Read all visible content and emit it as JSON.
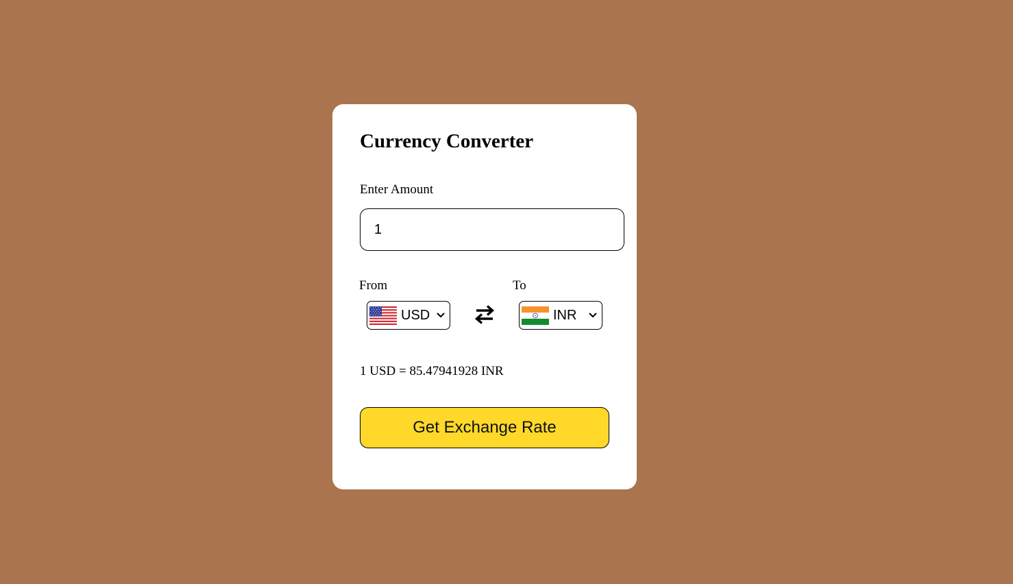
{
  "app": {
    "title": "Currency Converter"
  },
  "amount": {
    "label": "Enter Amount",
    "value": "1"
  },
  "from": {
    "label": "From",
    "currency": "USD",
    "flag_icon": "us-flag-icon"
  },
  "to": {
    "label": "To",
    "currency": "INR",
    "flag_icon": "india-flag-icon"
  },
  "swap": {
    "icon": "swap-arrows-icon"
  },
  "result": {
    "text": "1 USD = 85.47941928 INR"
  },
  "actions": {
    "get_rate_label": "Get Exchange Rate"
  },
  "colors": {
    "background": "#a9744e",
    "card": "#ffffff",
    "button": "#ffd82a"
  }
}
